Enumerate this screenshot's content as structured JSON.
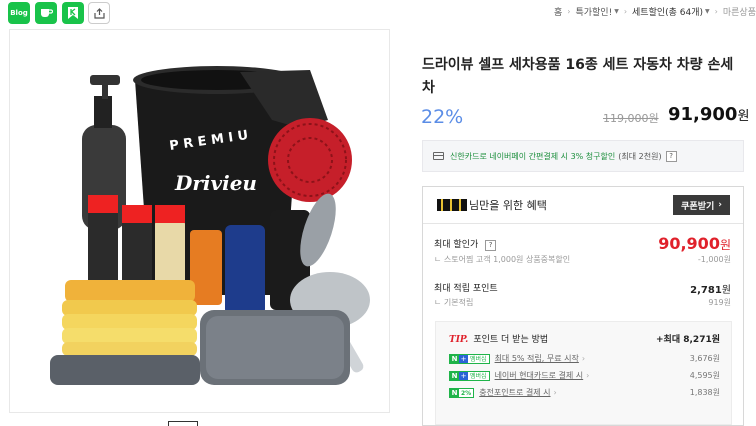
{
  "share": {
    "blog_label": "Blog"
  },
  "breadcrumb": {
    "home": "홈",
    "special": "특가할인!",
    "set_sale": "세트할인(총 64개)",
    "more": "마른상품"
  },
  "product": {
    "title": "드라이뷰 셀프 세차용품 16종 세트 자동차 차량 손세차",
    "discount": "22%",
    "original_price": "119,000원",
    "sale_price": "91,900",
    "won": "원"
  },
  "card_promo": {
    "text": "신한카드로 네이버페이 간편결제 시 3% 청구할인",
    "sub": "(최대 2천원)",
    "help": "?"
  },
  "benefits": {
    "title": "님만을 위한 혜택",
    "coupon_button": "쿠폰받기",
    "max_discount_label": "최대 할인가",
    "max_discount_value": "90,900",
    "max_discount_won": "원",
    "store_sub_label": "스토어찜 고객 1,000원 상품중복할인",
    "store_sub_value": "-1,000원",
    "max_points_label": "최대 적립 포인트",
    "max_points_value": "2,781",
    "max_points_won": "원",
    "base_points_label": "기본적립",
    "base_points_value": "919원",
    "tip": {
      "tip_word": "TIP.",
      "heading": "포인트 더 받는 방법",
      "max_label": "+최대 8,271원",
      "items": [
        {
          "badge_kind": "member",
          "badge_text": "멤버십",
          "text": "최대 5% 적립, 무료 시작",
          "value": "3,676원"
        },
        {
          "badge_kind": "member",
          "badge_text": "멤버십",
          "text": "네이버 현대카드로 결제 시",
          "value": "4,595원"
        },
        {
          "badge_kind": "pct",
          "badge_text": "2%",
          "text": "충전포인트로 결제 시",
          "value": "1,838원"
        }
      ]
    }
  },
  "colors": {
    "accent_blue": "#5b8de6",
    "price_red": "#e0212b",
    "naver_green": "#1fb449",
    "card_green": "#1d8f3d"
  }
}
